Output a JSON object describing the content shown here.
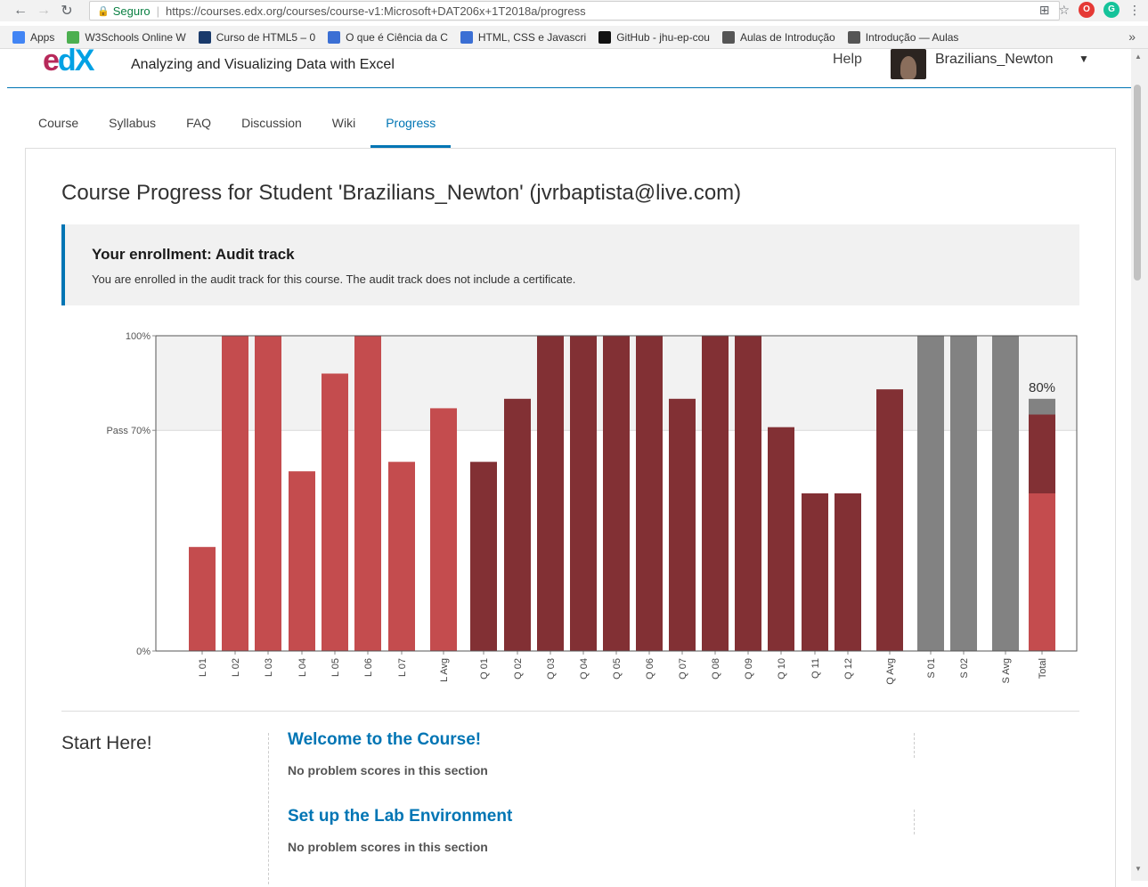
{
  "browser": {
    "secure_label": "Seguro",
    "url": "https://courses.edx.org/courses/course-v1:Microsoft+DAT206x+1T2018a/progress",
    "bookmarks": [
      {
        "label": "Apps",
        "color": "#4285f4"
      },
      {
        "label": "W3Schools Online W",
        "color": "#4caf50"
      },
      {
        "label": "Curso de HTML5 – 0",
        "color": "#1a3a6b"
      },
      {
        "label": "O que é Ciência da C",
        "color": "#3b6fd4"
      },
      {
        "label": "HTML, CSS e Javascri",
        "color": "#3b6fd4"
      },
      {
        "label": "GitHub - jhu-ep-cou",
        "color": "#111111"
      },
      {
        "label": "Aulas de Introdução",
        "color": "#555555"
      },
      {
        "label": "Introdução — Aulas",
        "color": "#555555"
      }
    ],
    "more": "»"
  },
  "header": {
    "logo_e": "e",
    "logo_dx": "dX",
    "course_name": "Analyzing and Visualizing Data with Excel",
    "help": "Help",
    "username": "Brazilians_Newton"
  },
  "tabs": [
    {
      "label": "Course"
    },
    {
      "label": "Syllabus"
    },
    {
      "label": "FAQ"
    },
    {
      "label": "Discussion"
    },
    {
      "label": "Wiki"
    },
    {
      "label": "Progress",
      "active": true
    }
  ],
  "main": {
    "title": "Course Progress for Student 'Brazilians_Newton' (jvrbaptista@live.com)",
    "enrollment_title": "Your enrollment: Audit track",
    "enrollment_text": "You are enrolled in the audit track for this course. The audit track does not include a certificate.",
    "section_title": "Start Here!",
    "subsections": [
      {
        "title": "Welcome to the Course!",
        "note": "No problem scores in this section"
      },
      {
        "title": "Set up the Lab Environment",
        "note": "No problem scores in this section"
      }
    ]
  },
  "chart_data": {
    "type": "bar",
    "ylim": [
      0,
      100
    ],
    "yticks": [
      {
        "value": 100,
        "label": "100%"
      },
      {
        "value": 70,
        "label": "Pass 70%"
      },
      {
        "value": 0,
        "label": "0%"
      }
    ],
    "pass_band": [
      70,
      100
    ],
    "colors": {
      "lab": "#c44c4e",
      "quiz": "#823034",
      "dropped": "#828282",
      "band": "#f2f2f2"
    },
    "categories": [
      "L 01",
      "L 02",
      "L 03",
      "L 04",
      "L 05",
      "L 06",
      "L 07",
      "L Avg",
      "Q 01",
      "Q 02",
      "Q 03",
      "Q 04",
      "Q 05",
      "Q 06",
      "Q 07",
      "Q 08",
      "Q 09",
      "Q 10",
      "Q 11",
      "Q 12",
      "Q Avg",
      "S 01",
      "S 02",
      "S Avg",
      "Total"
    ],
    "values": [
      33,
      100,
      100,
      57,
      88,
      100,
      60,
      77,
      60,
      80,
      100,
      100,
      100,
      100,
      80,
      100,
      100,
      71,
      50,
      50,
      83,
      100,
      100,
      100,
      80
    ],
    "groups": [
      "lab",
      "lab",
      "lab",
      "lab",
      "lab",
      "lab",
      "lab",
      "lab",
      "quiz",
      "quiz",
      "quiz",
      "quiz",
      "quiz",
      "quiz",
      "quiz",
      "quiz",
      "quiz",
      "quiz",
      "quiz",
      "quiz",
      "quiz",
      "dropped",
      "dropped",
      "dropped",
      "total"
    ],
    "total_stack": [
      {
        "group": "lab",
        "value": 50
      },
      {
        "group": "quiz",
        "value": 25
      },
      {
        "group": "dropped",
        "value": 5
      }
    ],
    "total_label": "80%"
  }
}
